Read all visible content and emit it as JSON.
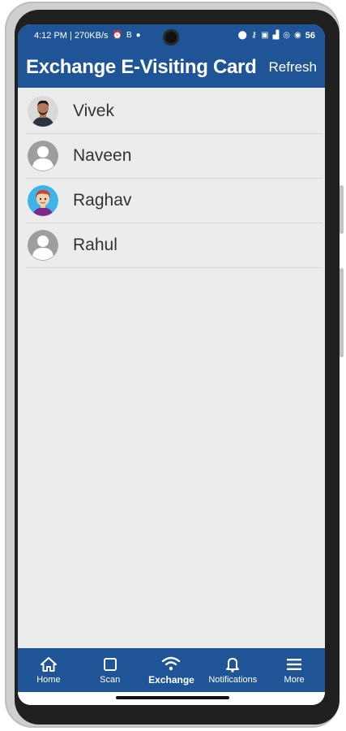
{
  "status_bar": {
    "time_and_speed": "4:12 PM | 270KB/s",
    "battery": "56"
  },
  "header": {
    "title": "Exchange E-Visiting Card",
    "refresh_label": "Refresh"
  },
  "contacts": [
    {
      "name": "Vivek",
      "avatar": "photo-avatar"
    },
    {
      "name": "Naveen",
      "avatar": "default-avatar"
    },
    {
      "name": "Raghav",
      "avatar": "cartoon-avatar"
    },
    {
      "name": "Rahul",
      "avatar": "default-avatar"
    }
  ],
  "nav": [
    {
      "label": "Home",
      "icon": "home-icon"
    },
    {
      "label": "Scan",
      "icon": "scan-icon"
    },
    {
      "label": "Exchange",
      "icon": "wifi-icon",
      "active": true
    },
    {
      "label": "Notifications",
      "icon": "bell-icon"
    },
    {
      "label": "More",
      "icon": "menu-icon"
    }
  ],
  "colors": {
    "primary": "#1f5596",
    "background": "#ececec",
    "divider": "#d6d6d6"
  }
}
